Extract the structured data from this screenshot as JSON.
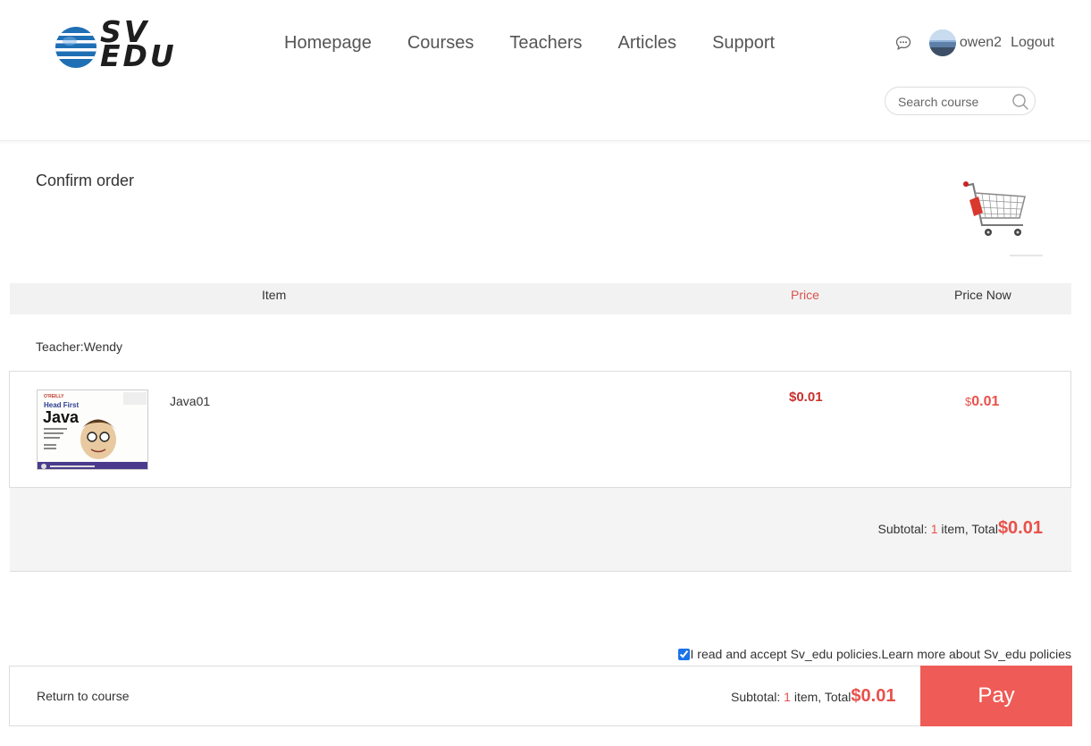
{
  "brand": {
    "logo_text_line1": "SV",
    "logo_text_line2": "EDU"
  },
  "nav": {
    "items": [
      "Homepage",
      "Courses",
      "Teachers",
      "Articles",
      "Support"
    ]
  },
  "user": {
    "name": "owen2",
    "logout_label": "Logout",
    "icons": [
      "message-icon",
      "avatar"
    ]
  },
  "search": {
    "placeholder": "Search course",
    "icon": "search-icon"
  },
  "page": {
    "title": "Confirm order",
    "cart_icon": "shopping-cart-icon"
  },
  "table": {
    "headers": {
      "item": "Item",
      "price": "Price",
      "price_now": "Price Now"
    },
    "teacher_label": "Teacher:Wendy",
    "rows": [
      {
        "cover_title": "Head First",
        "cover_big": "Java",
        "cover_publisher": "O'REILLY",
        "name": "Java01",
        "price": "$0.01",
        "price_now_currency": "$",
        "price_now_value": "0.01"
      }
    ]
  },
  "subtotal": {
    "prefix": "Subtotal: ",
    "count": "1",
    "suffix": " item, Total",
    "total": "$0.01"
  },
  "policy": {
    "text": "I read and accept Sv_edu policies.Learn more about Sv_edu policies",
    "checked": true
  },
  "footer": {
    "return_label": "Return to course",
    "subtotal_prefix": "Subtotal: ",
    "count": "1",
    "subtotal_suffix": " item, Total",
    "total": "$0.01",
    "pay_label": "Pay"
  },
  "colors": {
    "accent": "#ef5b57",
    "price_red": "#e8514b",
    "header_bg": "#f2f2f2"
  }
}
